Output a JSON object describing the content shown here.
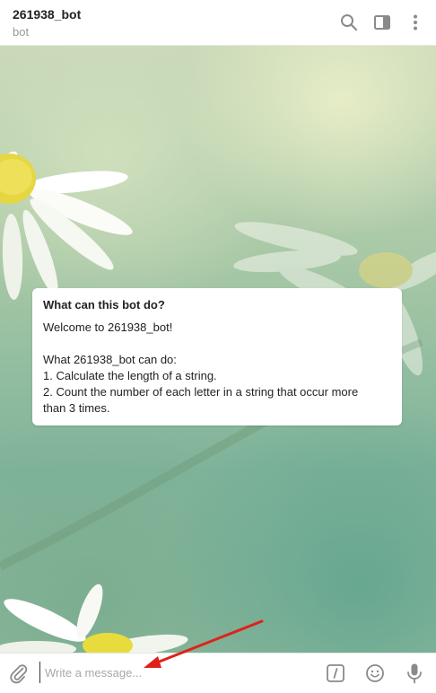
{
  "header": {
    "title": "261938_bot",
    "subtitle": "bot",
    "icons": [
      "search-icon",
      "sidebar-toggle-icon",
      "more-vertical-icon"
    ]
  },
  "bot_info": {
    "title": "What can this bot do?",
    "welcome": "Welcome to 261938_bot!",
    "intro": "What 261938_bot can do:",
    "items": [
      "1. Calculate the length of a string.",
      "2. Count the number of each letter in a string that occur more",
      "than 3 times."
    ]
  },
  "composer": {
    "placeholder": "Write a message...",
    "icons": [
      "attach-icon",
      "bot-command-icon",
      "emoji-icon",
      "microphone-icon"
    ]
  },
  "colors": {
    "annotation_arrow": "#e0211b",
    "header_title": "#222222",
    "header_subtitle": "#999999",
    "icon": "#8a8a8a"
  }
}
